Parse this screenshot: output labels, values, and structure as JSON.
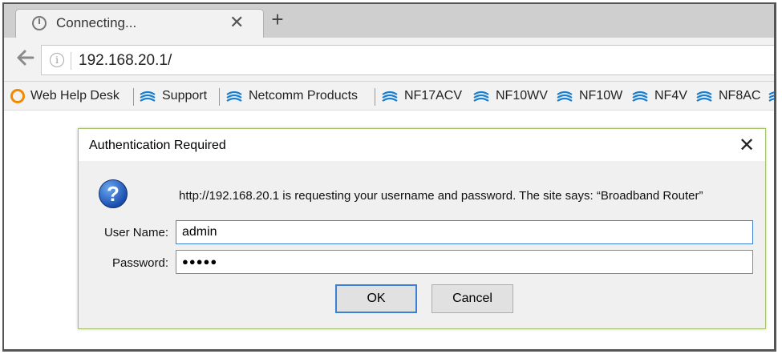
{
  "browser": {
    "tab": {
      "title": "Connecting...",
      "close_glyph": "✕"
    },
    "new_tab_glyph": "+",
    "back_glyph": "🡐",
    "address": {
      "info_glyph": "i",
      "url": "192.168.20.1/"
    },
    "bookmarks": [
      {
        "label": "Web Help Desk",
        "icon": "orange-ring-icon"
      },
      {
        "label": "Support",
        "icon": "netcomm-wave-icon"
      },
      {
        "label": "Netcomm Products",
        "icon": "netcomm-wave-icon"
      },
      {
        "label": "NF17ACV",
        "icon": "netcomm-wave-icon"
      },
      {
        "label": "NF10WV",
        "icon": "netcomm-wave-icon"
      },
      {
        "label": "NF10W",
        "icon": "netcomm-wave-icon"
      },
      {
        "label": "NF4V",
        "icon": "netcomm-wave-icon"
      },
      {
        "label": "NF8AC",
        "icon": "netcomm-wave-icon"
      }
    ]
  },
  "dialog": {
    "title": "Authentication Required",
    "close_glyph": "✕",
    "icon_glyph": "?",
    "message": "http://192.168.20.1 is requesting your username and password. The site says: “Broadband Router”",
    "username_label": "User Name:",
    "username_value": "admin",
    "password_label": "Password:",
    "password_value": "●●●●●",
    "ok_label": "OK",
    "cancel_label": "Cancel"
  },
  "colors": {
    "accent_blue": "#3c7fd6",
    "dialog_border": "#a6c36a",
    "bookmark_wave": "#1b7fd1",
    "orange_icon": "#f08a00"
  }
}
